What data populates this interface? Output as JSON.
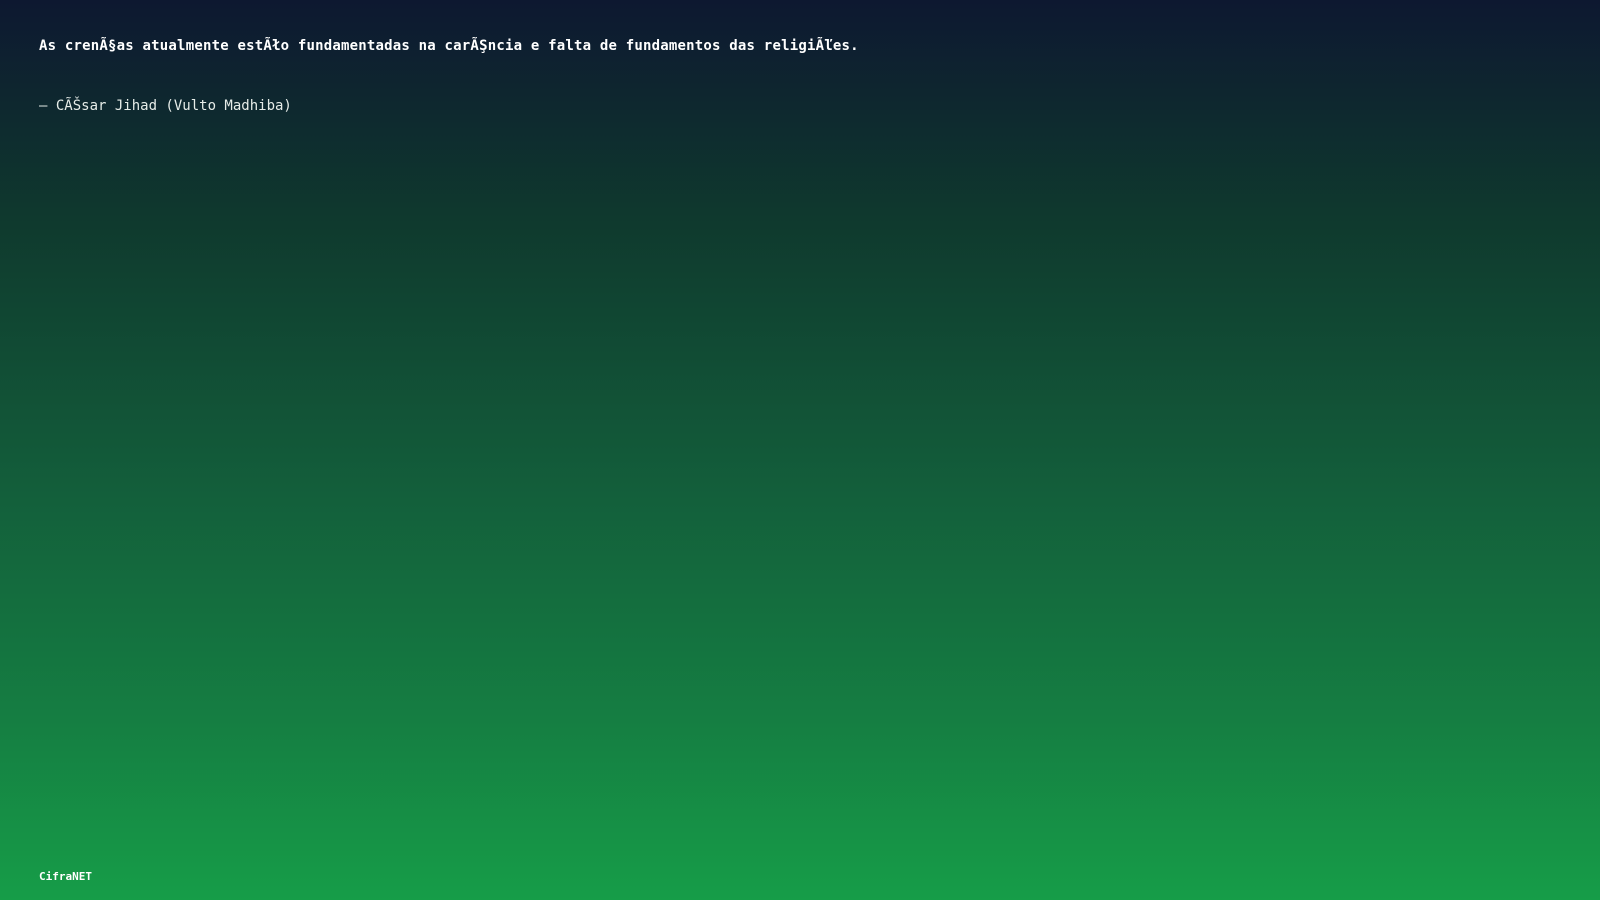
{
  "quote": {
    "text": "As crenÃ§as atualmente estÃło fundamentadas na carÃŞncia e falta de fundamentos das religiÃľes.",
    "author": "– CÃŠsar Jihad (Vulto Madhiba)"
  },
  "footer": {
    "brand": "CifraNET"
  }
}
